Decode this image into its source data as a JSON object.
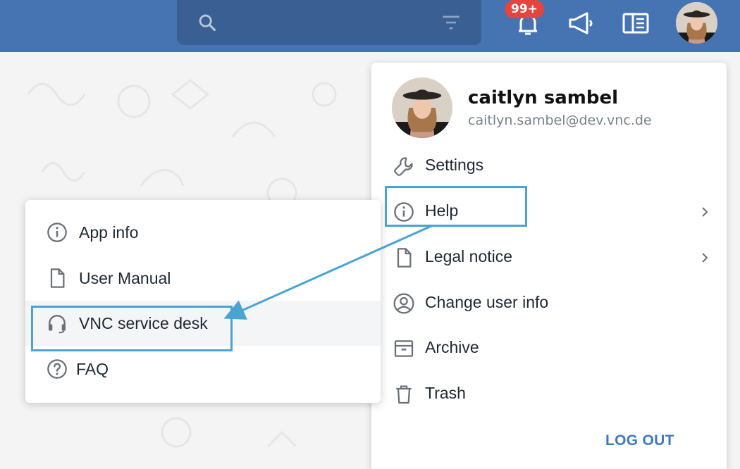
{
  "header": {
    "search": {
      "value": "",
      "placeholder": ""
    },
    "notifications": {
      "badge": "99+"
    }
  },
  "profile": {
    "name": "caitlyn sambel",
    "email": "caitlyn.sambel@dev.vnc.de",
    "menu": [
      {
        "label": "Settings",
        "icon": "wrench-icon"
      },
      {
        "label": "Help",
        "icon": "info-icon",
        "submenu": true
      },
      {
        "label": "Legal notice",
        "icon": "document-icon",
        "submenu": true
      },
      {
        "label": "Change user info",
        "icon": "account-circle-icon"
      },
      {
        "label": "Archive",
        "icon": "archive-icon"
      },
      {
        "label": "Trash",
        "icon": "trash-icon"
      }
    ],
    "logout_label": "LOG OUT"
  },
  "help_menu": {
    "items": [
      {
        "label": "App info",
        "icon": "info-icon"
      },
      {
        "label": "User Manual",
        "icon": "document-icon"
      },
      {
        "label": "VNC service desk",
        "icon": "headset-icon",
        "active": true
      },
      {
        "label": "FAQ",
        "icon": "question-icon"
      }
    ]
  },
  "colors": {
    "header": "#4674b2",
    "search_bg": "#3a5f92",
    "badge": "#e3453f",
    "accent": "#3f79bd",
    "annotation": "#4aa3d1"
  }
}
